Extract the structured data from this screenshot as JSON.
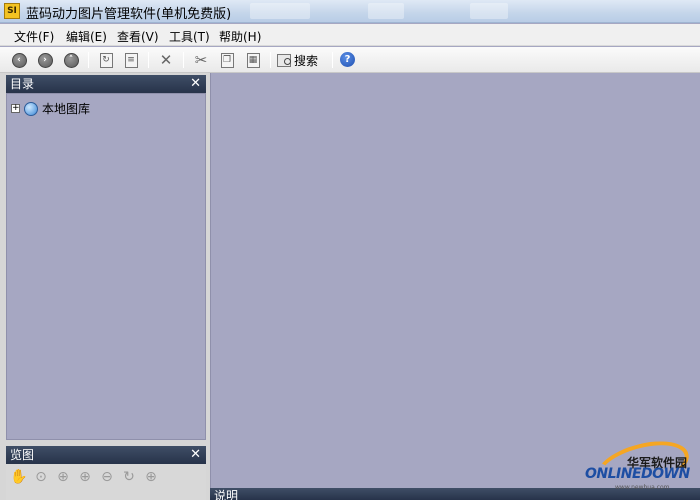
{
  "window": {
    "title": "蓝码动力图片管理软件(单机免费版)",
    "icon_label": "SI"
  },
  "menu": {
    "items": [
      "文件(F)",
      "编辑(E)",
      "查看(V)",
      "工具(T)",
      "帮助(H)"
    ]
  },
  "toolbar": {
    "search_label": "搜索",
    "icons": [
      "back-icon",
      "forward-icon",
      "up-icon",
      "refresh-icon",
      "properties-icon",
      "delete-icon",
      "cut-icon",
      "copy-icon",
      "paste-icon",
      "search-icon",
      "help-icon"
    ]
  },
  "directory": {
    "title": "目录",
    "tree": [
      {
        "label": "本地图库",
        "icon": "globe-icon",
        "expander": "+"
      }
    ]
  },
  "preview": {
    "title": "览图",
    "tools": [
      "pan-icon",
      "zoom-fit-icon",
      "zoom-actual-icon",
      "zoom-in-icon",
      "zoom-out-icon",
      "rotate-icon",
      "zoom-custom-icon"
    ]
  },
  "description": {
    "title": "说明"
  },
  "watermark": {
    "cn": "华军软件园",
    "en": "ONLINEDOWN",
    "url": "www.newhua.com"
  }
}
